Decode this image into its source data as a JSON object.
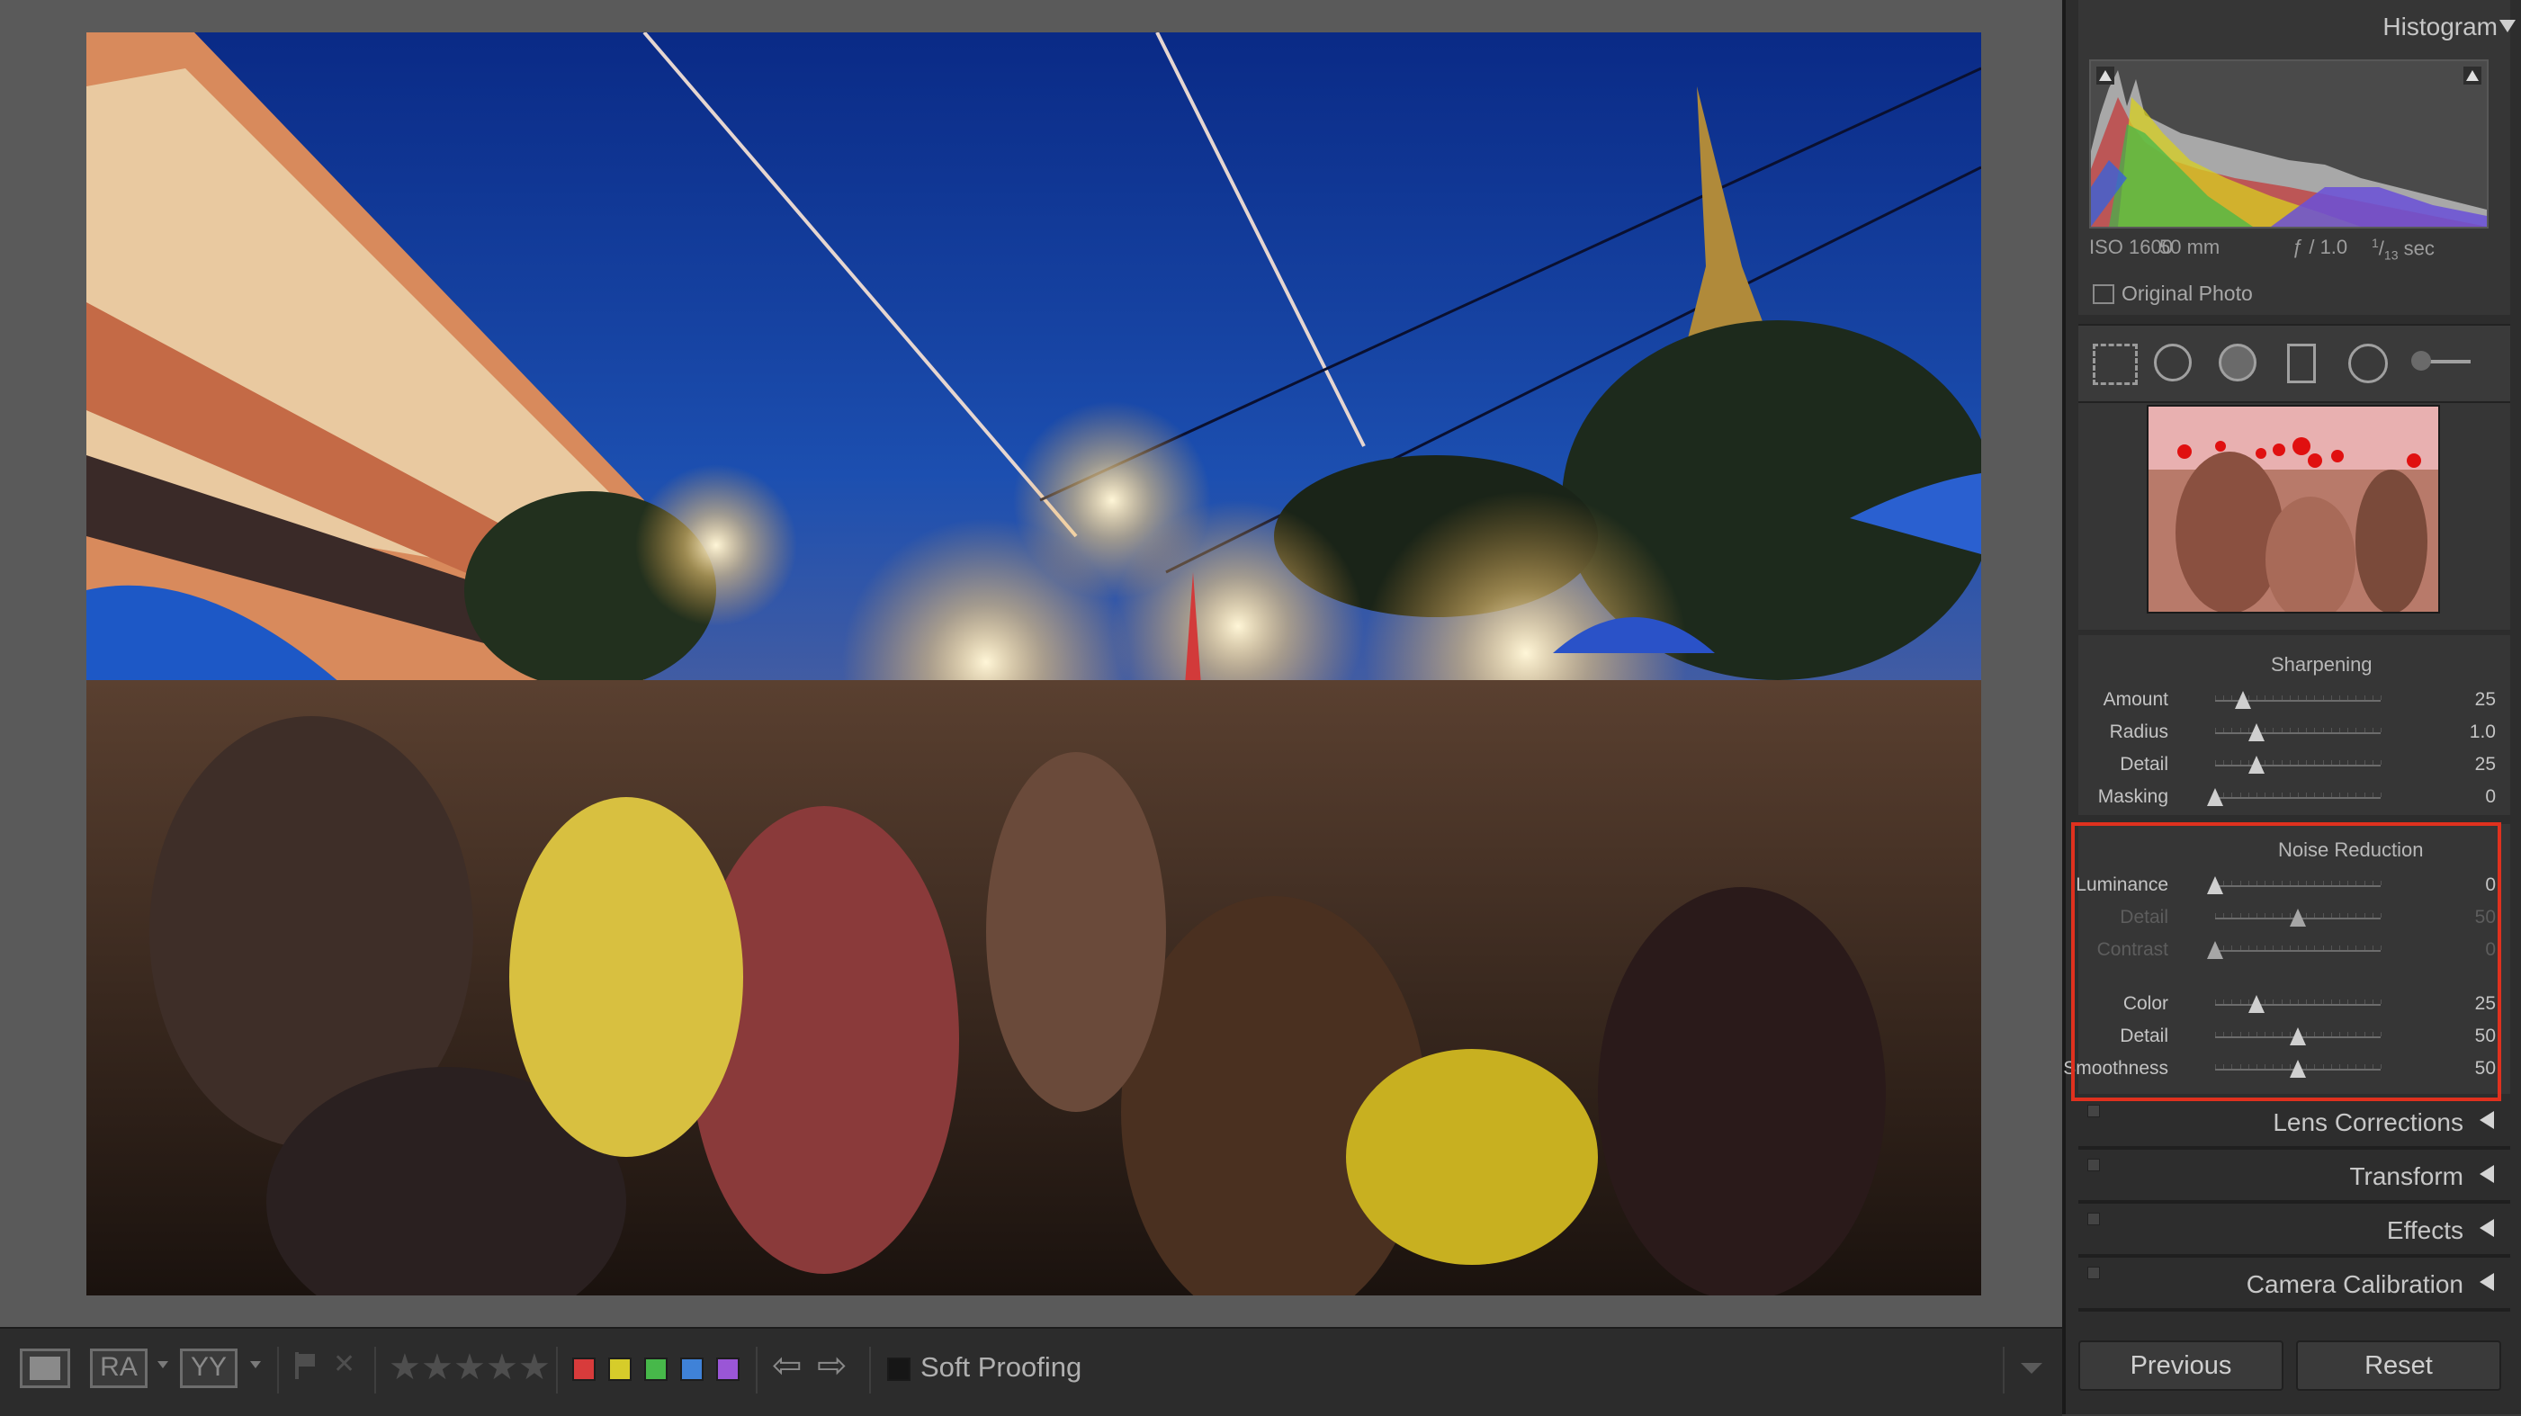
{
  "histogram": {
    "title": "Histogram",
    "iso": "ISO 1600",
    "focal": "50 mm",
    "aperture": "ƒ / 1.0",
    "shutter_num": "1",
    "shutter_den": "13",
    "shutter_unit": "sec",
    "original_photo": "Original Photo"
  },
  "sharpening": {
    "title": "Sharpening",
    "rows": [
      {
        "label": "Amount",
        "value": "25",
        "pos": 0.17
      },
      {
        "label": "Radius",
        "value": "1.0",
        "pos": 0.25
      },
      {
        "label": "Detail",
        "value": "25",
        "pos": 0.25
      },
      {
        "label": "Masking",
        "value": "0",
        "pos": 0.0
      }
    ]
  },
  "noise_reduction": {
    "title": "Noise Reduction",
    "rows": [
      {
        "label": "Luminance",
        "value": "0",
        "pos": 0.0,
        "dim": false
      },
      {
        "label": "Detail",
        "value": "50",
        "pos": 0.5,
        "dim": true
      },
      {
        "label": "Contrast",
        "value": "0",
        "pos": 0.0,
        "dim": true
      },
      {
        "label": "Color",
        "value": "25",
        "pos": 0.25,
        "dim": false
      },
      {
        "label": "Detail",
        "value": "50",
        "pos": 0.5,
        "dim": false
      },
      {
        "label": "Smoothness",
        "value": "50",
        "pos": 0.5,
        "dim": false
      }
    ]
  },
  "collapsed_panels": [
    "Lens Corrections",
    "Transform",
    "Effects",
    "Camera Calibration"
  ],
  "buttons": {
    "previous": "Previous",
    "reset": "Reset"
  },
  "toolbar": {
    "soft_proofing": "Soft Proofing",
    "view_ra": "RA",
    "view_yy": "YY",
    "rating": 0,
    "color_labels": [
      "#d83b3b",
      "#d6cc2a",
      "#47b84a",
      "#3f82d8",
      "#9a56d6"
    ]
  },
  "colors": {
    "highlight": "#e0311e",
    "panel_bg": "#2d2d2d"
  }
}
